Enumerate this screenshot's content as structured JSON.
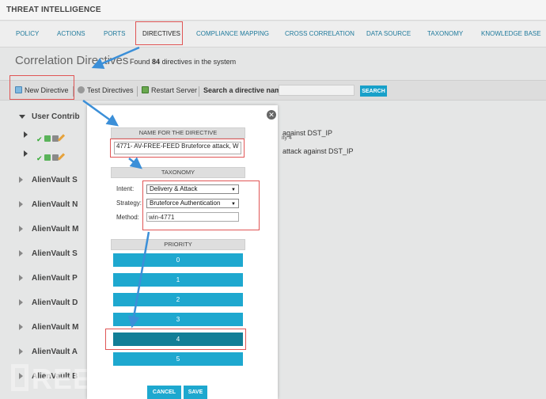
{
  "app_title": "THREAT INTELLIGENCE",
  "tabs": [
    {
      "label": "POLICY"
    },
    {
      "label": "ACTIONS"
    },
    {
      "label": "PORTS"
    },
    {
      "label": "DIRECTIVES"
    },
    {
      "label": "COMPLIANCE MAPPING"
    },
    {
      "label": "CROSS CORRELATION"
    },
    {
      "label": "DATA SOURCE"
    },
    {
      "label": "TAXONOMY"
    },
    {
      "label": "KNOWLEDGE BASE"
    }
  ],
  "page": {
    "heading": "Correlation Directives",
    "count_prefix": "Found",
    "count_value": "84",
    "count_suffix": "directives in the system"
  },
  "toolbar": {
    "new_directive": "New Directive",
    "test_directives": "Test Directives",
    "restart_server": "Restart Server",
    "search_label": "Search a directive name:",
    "search_value": "",
    "search_button": "SEARCH"
  },
  "tree": {
    "group_user": "User Contrib",
    "row1_text": "against DST_IP",
    "row1_sub": "ity 4",
    "row2_text": "attack against DST_IP",
    "groups": [
      "AlienVault S",
      "AlienVault N",
      "AlienVault M",
      "AlienVault S",
      "AlienVault P",
      "AlienVault D",
      "AlienVault M",
      "AlienVault A",
      "AlienVault B"
    ]
  },
  "watermark": "REEBUF",
  "modal": {
    "name_header": "NAME FOR THE DIRECTIVE",
    "name_value": "4771- AV-FREE-FEED Bruteforce attack, W",
    "taxonomy_header": "TAXONOMY",
    "intent_label": "Intent:",
    "intent_value": "Delivery & Attack",
    "strategy_label": "Strategy:",
    "strategy_value": "Bruteforce Authentication",
    "method_label": "Method:",
    "method_value": "win-4771",
    "priority_header": "PRIORITY",
    "priorities": [
      "0",
      "1",
      "2",
      "3",
      "4",
      "5"
    ],
    "selected_priority": "4",
    "cancel": "CANCEL",
    "save": "SAVE"
  },
  "colors": {
    "accent": "#1ea8cf",
    "accent_selected": "#117e97",
    "highlight": "#e05555",
    "arrow": "#3b8fd8"
  }
}
